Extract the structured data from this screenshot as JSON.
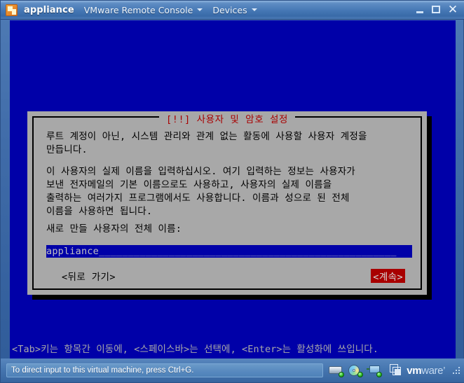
{
  "window": {
    "title": "appliance",
    "icon": "vm-appliance-icon",
    "menus": [
      {
        "label": "VMware Remote Console",
        "has_caret": true
      },
      {
        "label": "Devices",
        "has_caret": true
      }
    ],
    "controls": {
      "minimize": "minimize-button",
      "maximize": "maximize-button",
      "close": "✕"
    }
  },
  "vm": {
    "background_color": "#0000a8",
    "dialog": {
      "title": "[!!] 사용자 및 암호 설정",
      "title_color": "#a80000",
      "background_color": "#a8a8a8",
      "paragraph1": "루트 계정이 아닌, 시스템 관리와 관계 없는 활동에 사용할 사용자 계정을\n만듭니다.",
      "paragraph2": "이 사용자의 실제 이름을 입력하십시오. 여기 입력하는 정보는 사용자가\n보낸 전자메일의 기본 이름으로도 사용하고, 사용자의 실제 이름을\n출력하는 여러가지 프로그램에서도 사용합니다. 이름과 성으로 된 전체\n이름을 사용하면 됩니다.",
      "prompt": "새로 만들 사용자의 전체 이름:",
      "input": {
        "value": "appliance",
        "display": "appliance___________________________________________________",
        "background_color": "#0000a8",
        "text_color": "#c0c0c0"
      },
      "buttons": {
        "back": "<뒤로 가기>",
        "continue": "<계속>",
        "continue_selected": true,
        "continue_background": "#a80000"
      }
    },
    "help_line": "<Tab>키는 항목간 이동에, <스페이스바>는 선택에, <Enter>는 활성화에 쓰입니다."
  },
  "statusbar": {
    "message": "To direct input to this virtual machine, press Ctrl+G.",
    "devices": [
      {
        "name": "hard-disk-icon",
        "state": "connected"
      },
      {
        "name": "cd-dvd-icon",
        "state": "connected"
      },
      {
        "name": "network-adapter-icon",
        "state": "connected"
      }
    ],
    "brand": {
      "vm": "vm",
      "ware": "ware",
      "tm": "’"
    }
  }
}
